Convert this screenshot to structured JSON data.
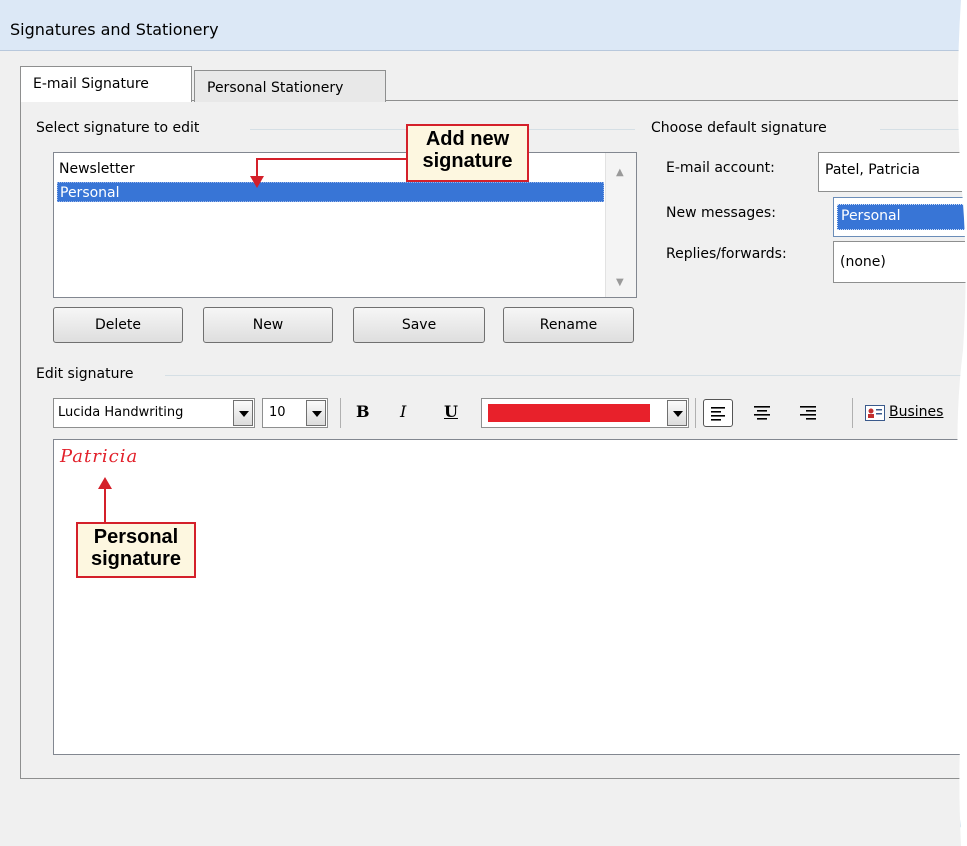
{
  "window": {
    "title": "Signatures and Stationery"
  },
  "tabs": [
    {
      "label": "E-mail Signature",
      "selected": true
    },
    {
      "label": "Personal Stationery",
      "selected": false
    }
  ],
  "select_group": {
    "label": "Select signature to edit",
    "items": [
      {
        "label": "Newsletter",
        "selected": false
      },
      {
        "label": "Personal",
        "selected": true
      }
    ],
    "buttons": {
      "delete": "Delete",
      "new": "New",
      "save": "Save",
      "rename": "Rename"
    }
  },
  "default_group": {
    "label": "Choose default signature",
    "email_account_label": "E-mail account:",
    "email_account_value": "Patel, Patricia",
    "new_messages_label": "New messages:",
    "new_messages_value": "Personal",
    "replies_label": "Replies/forwards:",
    "replies_value": "(none)"
  },
  "edit_group": {
    "label": "Edit signature",
    "font_name": "Lucida Handwriting",
    "font_size": "10",
    "bold": "B",
    "italic": "I",
    "underline": "U",
    "font_color": "#e8212b",
    "business_card_label": "Busines",
    "signature_text": "Patricia",
    "signature_color": "#e2202a"
  },
  "callouts": {
    "add_new": "Add new signature",
    "personal": "Personal signature"
  }
}
